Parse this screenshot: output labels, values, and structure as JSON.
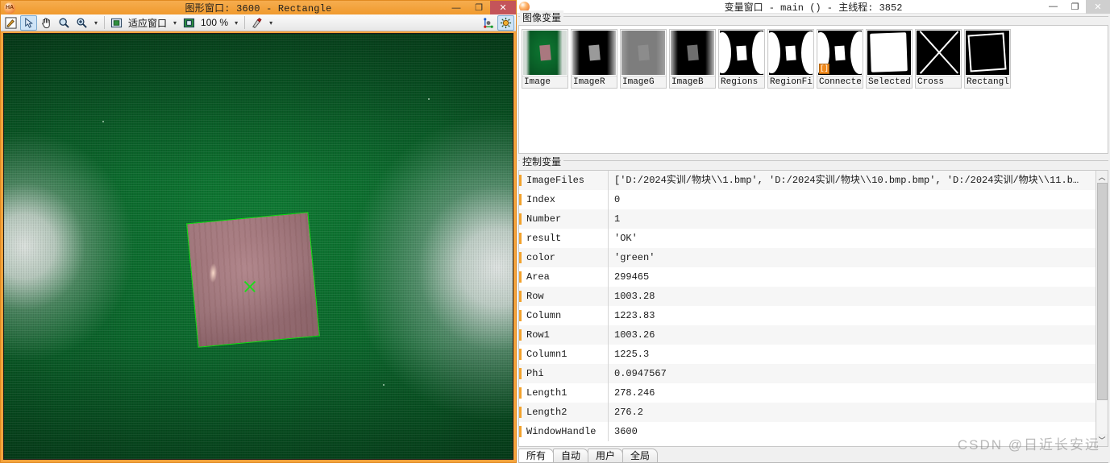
{
  "graphics_window": {
    "title": "图形窗口: 3600 - Rectangle",
    "logo_text": "HA",
    "window_controls": {
      "minimize": "—",
      "maximize": "❐",
      "close": "✕"
    },
    "toolbar": {
      "edit_label": "",
      "pointer_label": "",
      "pan_label": "",
      "zoom_label": "",
      "zoom_region_label": "",
      "caret1": "▾",
      "fit_window_label": "适应窗口",
      "caret2": "▾",
      "zoom_value": "100 %",
      "caret3": "▾",
      "color_label": "",
      "caret4": "▾"
    },
    "canvas": {
      "object_color": "#12e012",
      "cross_color": "#1ddc1d",
      "background_color": "#0a6129",
      "block_color": "#a9787f"
    }
  },
  "variable_window": {
    "title": "变量窗口 - main () - 主线程: 3852",
    "window_controls": {
      "minimize": "—",
      "maximize": "❐",
      "close": "✕"
    },
    "image_variables": {
      "group_label": "图像变量",
      "items": [
        {
          "label": "Image",
          "kind": "color",
          "badge": ""
        },
        {
          "label": "ImageR",
          "kind": "gray",
          "badge": ""
        },
        {
          "label": "ImageG",
          "kind": "mid",
          "badge": ""
        },
        {
          "label": "ImageB",
          "kind": "dark",
          "badge": ""
        },
        {
          "label": "Regions",
          "kind": "bin",
          "badge": ""
        },
        {
          "label": "RegionFi",
          "kind": "bin",
          "badge": ""
        },
        {
          "label": "Connecte",
          "kind": "bin",
          "badge": "[]"
        },
        {
          "label": "Selected",
          "kind": "white",
          "badge": ""
        },
        {
          "label": "Cross",
          "kind": "cross",
          "badge": ""
        },
        {
          "label": "Rectangl",
          "kind": "rect",
          "badge": ""
        }
      ]
    },
    "control_variables": {
      "group_label": "控制变量",
      "rows": [
        {
          "name": "ImageFiles",
          "value": "['D:/2024实训/物块\\\\1.bmp', 'D:/2024实训/物块\\\\10.bmp.bmp', 'D:/2024实训/物块\\\\11.b…"
        },
        {
          "name": "Index",
          "value": "0"
        },
        {
          "name": "Number",
          "value": "1"
        },
        {
          "name": "result",
          "value": "'OK'"
        },
        {
          "name": "color",
          "value": "'green'"
        },
        {
          "name": "Area",
          "value": "299465"
        },
        {
          "name": "Row",
          "value": "1003.28"
        },
        {
          "name": "Column",
          "value": "1223.83"
        },
        {
          "name": "Row1",
          "value": "1003.26"
        },
        {
          "name": "Column1",
          "value": "1225.3"
        },
        {
          "name": "Phi",
          "value": "0.0947567"
        },
        {
          "name": "Length1",
          "value": "278.246"
        },
        {
          "name": "Length2",
          "value": "276.2"
        },
        {
          "name": "WindowHandle",
          "value": "3600"
        }
      ],
      "scroll_up": "︿",
      "scroll_down": "﹀"
    },
    "tabs": [
      {
        "label": "所有",
        "active": true
      },
      {
        "label": "自动",
        "active": false
      },
      {
        "label": "用户",
        "active": false
      },
      {
        "label": "全局",
        "active": false
      }
    ]
  },
  "watermark": "CSDN @日近长安远"
}
